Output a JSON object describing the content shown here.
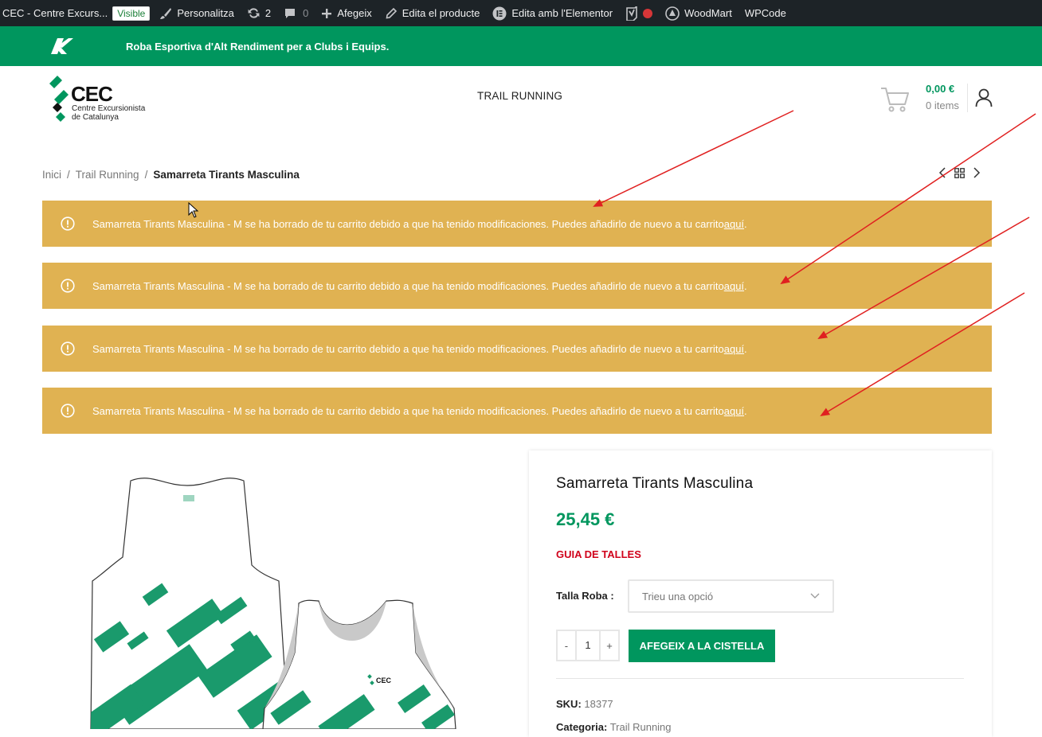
{
  "admin_bar": {
    "site": "CEC - Centre Excurs...",
    "visible_badge": "Visible",
    "customize": "Personalitza",
    "updates_count": "2",
    "comments_count": "0",
    "add_new": "Afegeix",
    "edit_product": "Edita el producte",
    "edit_elementor": "Edita amb l'Elementor",
    "woodmart": "WoodMart",
    "wpcode": "WPCode"
  },
  "promo": {
    "brand": "KRUX",
    "text": "Roba Esportiva d'Alt Rendiment per a Clubs i Equips."
  },
  "header": {
    "logo_main": "CEC",
    "logo_sub1": "Centre Excursionista",
    "logo_sub2": "de Catalunya",
    "nav_item": "TRAIL RUNNING",
    "cart_price": "0,00 €",
    "cart_items": "0 items"
  },
  "breadcrumb": {
    "home": "Inici",
    "category": "Trail Running",
    "current": "Samarreta Tirants Masculina"
  },
  "notices": [
    {
      "text": "Samarreta Tirants Masculina - M se ha borrado de tu carrito debido a que ha tenido modificaciones. Puedes añadirlo de nuevo a tu carrito ",
      "link": "aquí",
      "end": "."
    },
    {
      "text": "Samarreta Tirants Masculina - M se ha borrado de tu carrito debido a que ha tenido modificaciones. Puedes añadirlo de nuevo a tu carrito ",
      "link": "aquí",
      "end": "."
    },
    {
      "text": "Samarreta Tirants Masculina - M se ha borrado de tu carrito debido a que ha tenido modificaciones. Puedes añadirlo de nuevo a tu carrito ",
      "link": "aquí",
      "end": "."
    },
    {
      "text": "Samarreta Tirants Masculina - M se ha borrado de tu carrito debido a que ha tenido modificaciones. Puedes añadirlo de nuevo a tu carrito ",
      "link": "aquí",
      "end": "."
    }
  ],
  "product": {
    "title": "Samarreta Tirants Masculina",
    "price": "25,45 €",
    "size_guide": "GUIA DE TALLES",
    "size_label": "Talla Roba :",
    "size_placeholder": "Trieu una opció",
    "qty_minus": "-",
    "qty_value": "1",
    "qty_plus": "+",
    "add_to_cart": "AFEGEIX A LA CISTELLA",
    "sku_label": "SKU:",
    "sku_value": "18377",
    "category_label": "Categoria:",
    "category_value": "Trail Running",
    "shirt_logo": "CEC"
  },
  "colors": {
    "accent_green": "#00965e",
    "notice_bg": "#e0b252",
    "admin_bar_bg": "#1d2327",
    "annotation_arrow": "#e02020",
    "size_guide_red": "#d0021b"
  }
}
